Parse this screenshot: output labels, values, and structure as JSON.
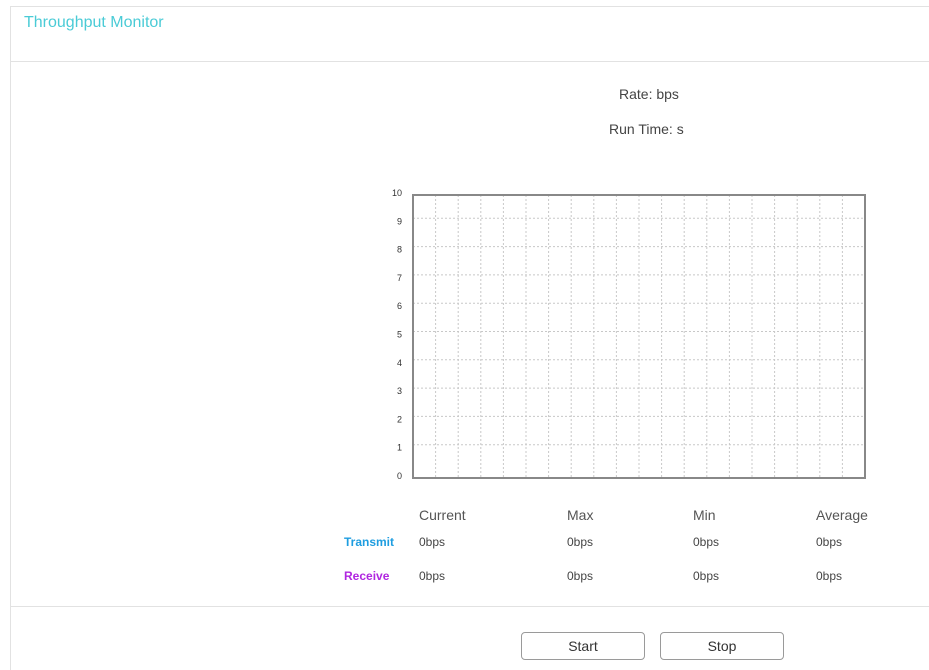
{
  "header": {
    "title": "Throughput Monitor"
  },
  "summary": {
    "rate_label": "Rate: bps",
    "runtime_label": "Run Time: s"
  },
  "chart_data": {
    "type": "line",
    "y_ticks": [
      "0",
      "1",
      "2",
      "3",
      "4",
      "5",
      "6",
      "7",
      "8",
      "9",
      "10"
    ],
    "ylim": [
      0,
      10
    ],
    "grid": true,
    "series": []
  },
  "stats": {
    "columns": [
      "Current",
      "Max",
      "Min",
      "Average"
    ],
    "rows": [
      {
        "label": "Transmit",
        "color": "#1e9de0",
        "values": [
          "0bps",
          "0bps",
          "0bps",
          "0bps"
        ]
      },
      {
        "label": "Receive",
        "color": "#b026e0",
        "values": [
          "0bps",
          "0bps",
          "0bps",
          "0bps"
        ]
      }
    ]
  },
  "buttons": {
    "start_label": "Start",
    "stop_label": "Stop"
  },
  "colors": {
    "title": "#4acbd6",
    "grid": "#c8c8c8",
    "plot_border": "#888888"
  }
}
